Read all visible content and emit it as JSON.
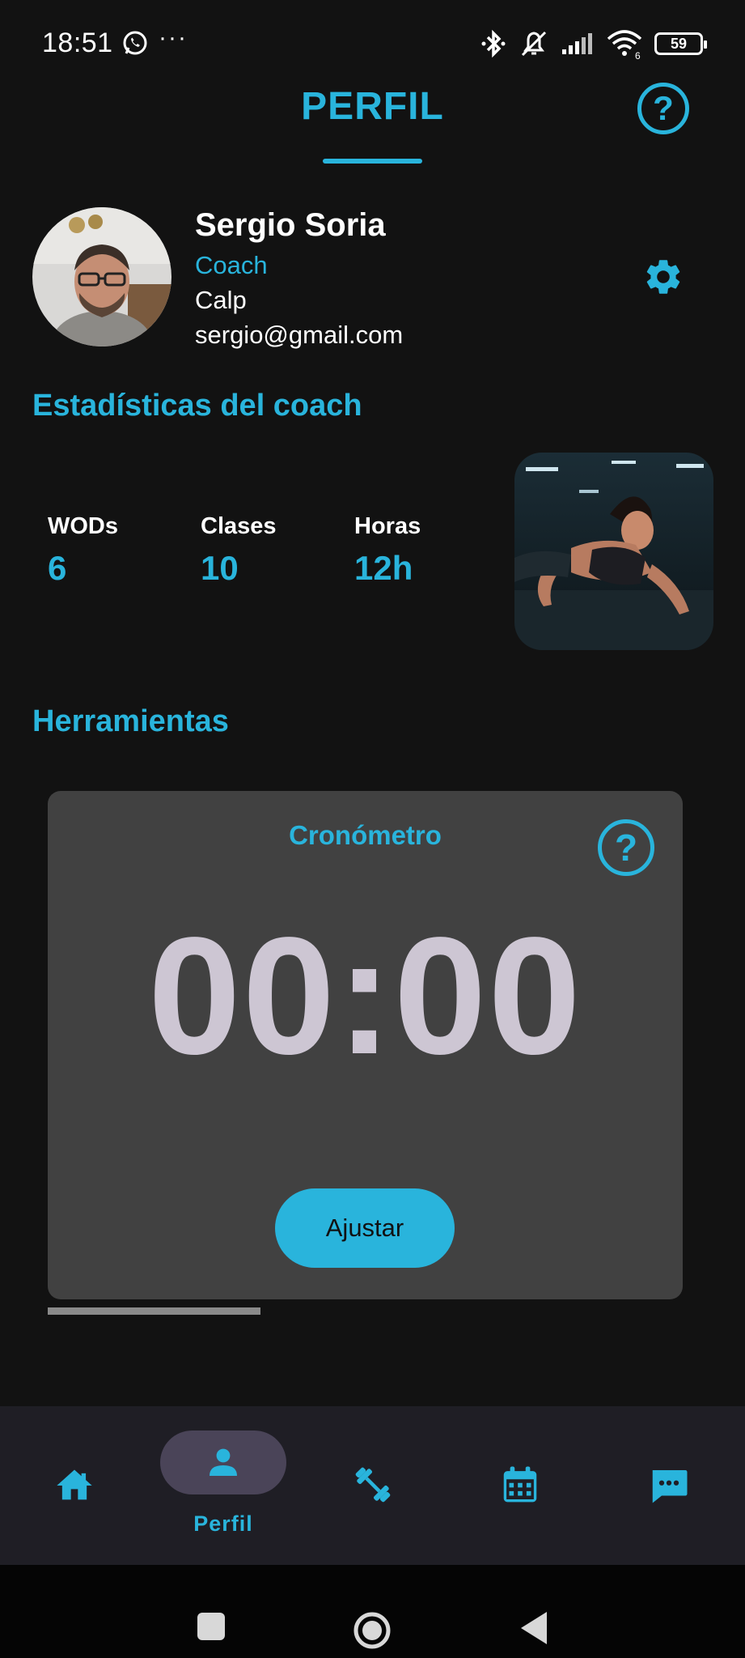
{
  "status_bar": {
    "time": "18:51",
    "dots": "···",
    "battery": "59",
    "wifi_badge": "6"
  },
  "header": {
    "title": "PERFIL",
    "help_symbol": "?"
  },
  "profile": {
    "name": "Sergio Soria",
    "role": "Coach",
    "city": "Calp",
    "email": "sergio@gmail.com"
  },
  "stats": {
    "title": "Estadísticas del coach",
    "items": [
      {
        "label": "WODs",
        "value": "6"
      },
      {
        "label": "Clases",
        "value": "10"
      },
      {
        "label": "Horas",
        "value": "12h"
      }
    ]
  },
  "tools": {
    "title": "Herramientas",
    "timer": {
      "title": "Cronómetro",
      "help_symbol": "?",
      "display": "00:00",
      "button_label": "Ajustar"
    }
  },
  "bottom_nav": {
    "active_label": "Perfil",
    "items": [
      "home-icon",
      "person-icon",
      "dumbbell-icon",
      "calendar-icon",
      "chat-icon"
    ]
  },
  "colors": {
    "accent": "#29b4dc",
    "background": "#121212",
    "card": "#414141",
    "timer_digits": "#cdc6d3",
    "nav_bg": "#1f1e25",
    "active_pill": "#4a4458"
  }
}
